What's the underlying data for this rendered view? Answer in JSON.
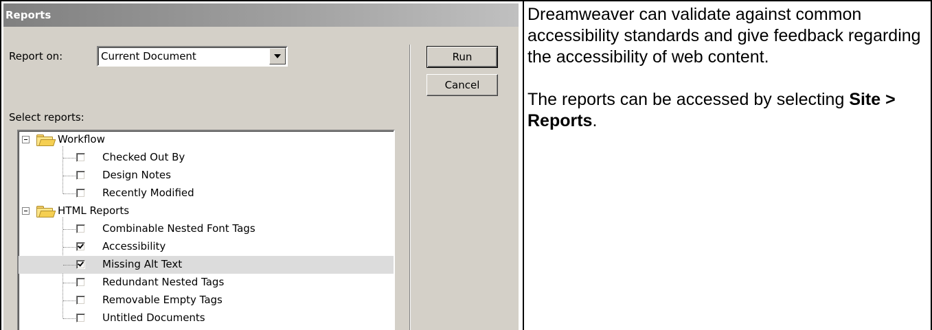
{
  "dialog": {
    "title": "Reports",
    "report_on_label": "Report on:",
    "report_on_value": "Current Document",
    "select_reports_label": "Select reports:",
    "run_label": "Run",
    "cancel_label": "Cancel",
    "groups": [
      {
        "label": "Workflow",
        "items": [
          {
            "label": "Checked Out By",
            "checked": false
          },
          {
            "label": "Design Notes",
            "checked": false
          },
          {
            "label": "Recently Modified",
            "checked": false
          }
        ]
      },
      {
        "label": "HTML Reports",
        "items": [
          {
            "label": "Combinable Nested Font Tags",
            "checked": false
          },
          {
            "label": "Accessibility",
            "checked": true
          },
          {
            "label": "Missing Alt Text",
            "checked": true,
            "highlighted": true
          },
          {
            "label": "Redundant Nested Tags",
            "checked": false
          },
          {
            "label": "Removable Empty Tags",
            "checked": false
          },
          {
            "label": "Untitled Documents",
            "checked": false
          }
        ]
      }
    ]
  },
  "description": {
    "paragraph1": "Dreamweaver can validate against common accessibility standards and give feedback regarding the accessibility of web content.",
    "paragraph2_prefix": "The reports can be accessed by selecting ",
    "paragraph2_bold": "Site > Reports",
    "paragraph2_suffix": "."
  }
}
